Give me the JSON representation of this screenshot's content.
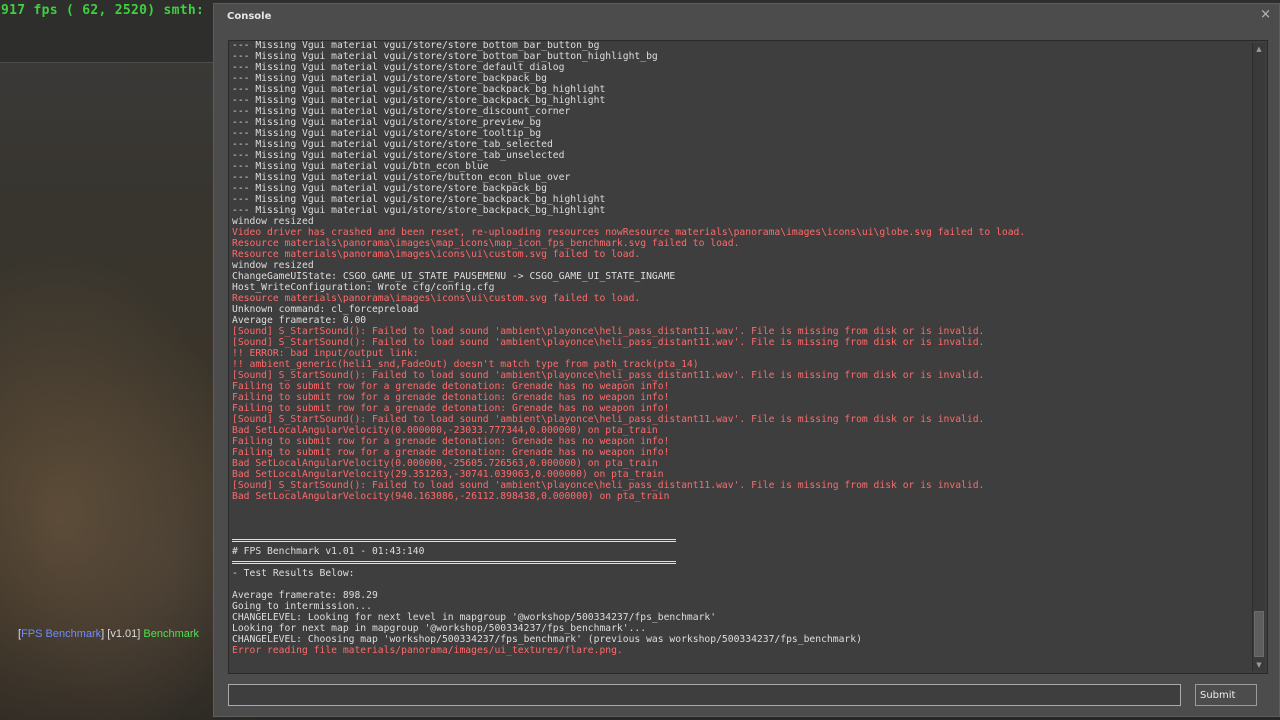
{
  "hud": {
    "fps_text": "917 fps ( 62, 2520) smth: 1",
    "tag_open": "[",
    "tag_name": "FPS Benchmark",
    "tag_mid": "] [",
    "tag_version": "v1.01",
    "tag_close": "]",
    "tag_mode": "Benchmark",
    "colors": {
      "fps": "#3fd13f",
      "name": "#6d8dff",
      "mode": "#4fe04f"
    }
  },
  "console": {
    "title": "Console",
    "close_label": "×",
    "submit_label": "Submit",
    "input_value": "",
    "lines": [
      {
        "t": "normal",
        "text": "--- Missing Vgui material vgui/store/store_bottom_bar_button_bg"
      },
      {
        "t": "normal",
        "text": "--- Missing Vgui material vgui/store/store_bottom_bar_button_highlight_bg"
      },
      {
        "t": "normal",
        "text": "--- Missing Vgui material vgui/store/store_default_dialog"
      },
      {
        "t": "normal",
        "text": "--- Missing Vgui material vgui/store/store_backpack_bg"
      },
      {
        "t": "normal",
        "text": "--- Missing Vgui material vgui/store/store_backpack_bg_highlight"
      },
      {
        "t": "normal",
        "text": "--- Missing Vgui material vgui/store/store_backpack_bg_highlight"
      },
      {
        "t": "normal",
        "text": "--- Missing Vgui material vgui/store/store_discount_corner"
      },
      {
        "t": "normal",
        "text": "--- Missing Vgui material vgui/store/store_preview_bg"
      },
      {
        "t": "normal",
        "text": "--- Missing Vgui material vgui/store/store_tooltip_bg"
      },
      {
        "t": "normal",
        "text": "--- Missing Vgui material vgui/store/store_tab_selected"
      },
      {
        "t": "normal",
        "text": "--- Missing Vgui material vgui/store/store_tab_unselected"
      },
      {
        "t": "normal",
        "text": "--- Missing Vgui material vgui/btn_econ_blue"
      },
      {
        "t": "normal",
        "text": "--- Missing Vgui material vgui/store/button_econ_blue_over"
      },
      {
        "t": "normal",
        "text": "--- Missing Vgui material vgui/store/store_backpack_bg"
      },
      {
        "t": "normal",
        "text": "--- Missing Vgui material vgui/store/store_backpack_bg_highlight"
      },
      {
        "t": "normal",
        "text": "--- Missing Vgui material vgui/store/store_backpack_bg_highlight"
      },
      {
        "t": "normal",
        "text": "window resized"
      },
      {
        "t": "error",
        "text": "Video driver has crashed and been reset, re-uploading resources nowResource materials\\panorama\\images\\icons\\ui\\globe.svg failed to load."
      },
      {
        "t": "error",
        "text": "Resource materials\\panorama\\images\\map_icons\\map_icon_fps_benchmark.svg failed to load."
      },
      {
        "t": "error",
        "text": "Resource materials\\panorama\\images\\icons\\ui\\custom.svg failed to load."
      },
      {
        "t": "normal",
        "text": "window resized"
      },
      {
        "t": "normal",
        "text": "ChangeGameUIState: CSGO_GAME_UI_STATE_PAUSEMENU -> CSGO_GAME_UI_STATE_INGAME"
      },
      {
        "t": "normal",
        "text": "Host_WriteConfiguration: Wrote cfg/config.cfg"
      },
      {
        "t": "error",
        "text": "Resource materials\\panorama\\images\\icons\\ui\\custom.svg failed to load."
      },
      {
        "t": "normal",
        "text": "Unknown command: cl_forcepreload"
      },
      {
        "t": "normal",
        "text": "Average framerate: 0.00"
      },
      {
        "t": "error",
        "text": "[Sound] S_StartSound(): Failed to load sound 'ambient\\playonce\\heli_pass_distant11.wav'. File is missing from disk or is invalid."
      },
      {
        "t": "error",
        "text": "[Sound] S_StartSound(): Failed to load sound 'ambient\\playonce\\heli_pass_distant11.wav'. File is missing from disk or is invalid."
      },
      {
        "t": "error",
        "text": "!! ERROR: bad input/output link:"
      },
      {
        "t": "error",
        "text": "!! ambient_generic(heli1_snd,FadeOut) doesn't match type from path_track(pta_14)"
      },
      {
        "t": "error",
        "text": "[Sound] S_StartSound(): Failed to load sound 'ambient\\playonce\\heli_pass_distant11.wav'. File is missing from disk or is invalid."
      },
      {
        "t": "error",
        "text": "Failing to submit row for a grenade detonation: Grenade has no weapon info!"
      },
      {
        "t": "error",
        "text": "Failing to submit row for a grenade detonation: Grenade has no weapon info!"
      },
      {
        "t": "error",
        "text": "Failing to submit row for a grenade detonation: Grenade has no weapon info!"
      },
      {
        "t": "error",
        "text": "[Sound] S_StartSound(): Failed to load sound 'ambient\\playonce\\heli_pass_distant11.wav'. File is missing from disk or is invalid."
      },
      {
        "t": "error",
        "text": "Bad SetLocalAngularVelocity(0.000000,-23033.777344,0.000000) on pta_train"
      },
      {
        "t": "error",
        "text": "Failing to submit row for a grenade detonation: Grenade has no weapon info!"
      },
      {
        "t": "error",
        "text": "Failing to submit row for a grenade detonation: Grenade has no weapon info!"
      },
      {
        "t": "error",
        "text": "Bad SetLocalAngularVelocity(0.000000,-25605.726563,0.000000) on pta_train"
      },
      {
        "t": "error",
        "text": "Bad SetLocalAngularVelocity(29.351263,-30741.039063,0.000000) on pta_train"
      },
      {
        "t": "error",
        "text": "[Sound] S_StartSound(): Failed to load sound 'ambient\\playonce\\heli_pass_distant11.wav'. File is missing from disk or is invalid."
      },
      {
        "t": "error",
        "text": "Bad SetLocalAngularVelocity(940.163086,-26112.898438,0.000000) on pta_train"
      },
      {
        "t": "normal",
        "text": ""
      },
      {
        "t": "normal",
        "text": ""
      },
      {
        "t": "normal",
        "text": ""
      },
      {
        "t": "divider",
        "text": ""
      },
      {
        "t": "normal",
        "text": "# FPS Benchmark v1.01 - 01:43:140"
      },
      {
        "t": "divider",
        "text": ""
      },
      {
        "t": "normal",
        "text": "- Test Results Below:"
      },
      {
        "t": "normal",
        "text": ""
      },
      {
        "t": "normal",
        "text": "Average framerate: 898.29"
      },
      {
        "t": "normal",
        "text": "Going to intermission..."
      },
      {
        "t": "normal",
        "text": "CHANGELEVEL: Looking for next level in mapgroup '@workshop/500334237/fps_benchmark'"
      },
      {
        "t": "normal",
        "text": "Looking for next map in mapgroup '@workshop/500334237/fps_benchmark'..."
      },
      {
        "t": "normal",
        "text": "CHANGELEVEL: Choosing map 'workshop/500334237/fps_benchmark' (previous was workshop/500334237/fps_benchmark)"
      },
      {
        "t": "error",
        "text": "Error reading file materials/panorama/images/ui_textures/flare.png."
      }
    ],
    "colors": {
      "normal": "#dedede",
      "error": "#ff6a6a",
      "window": "#4c4c4c",
      "panel": "#3e3e3e"
    }
  }
}
